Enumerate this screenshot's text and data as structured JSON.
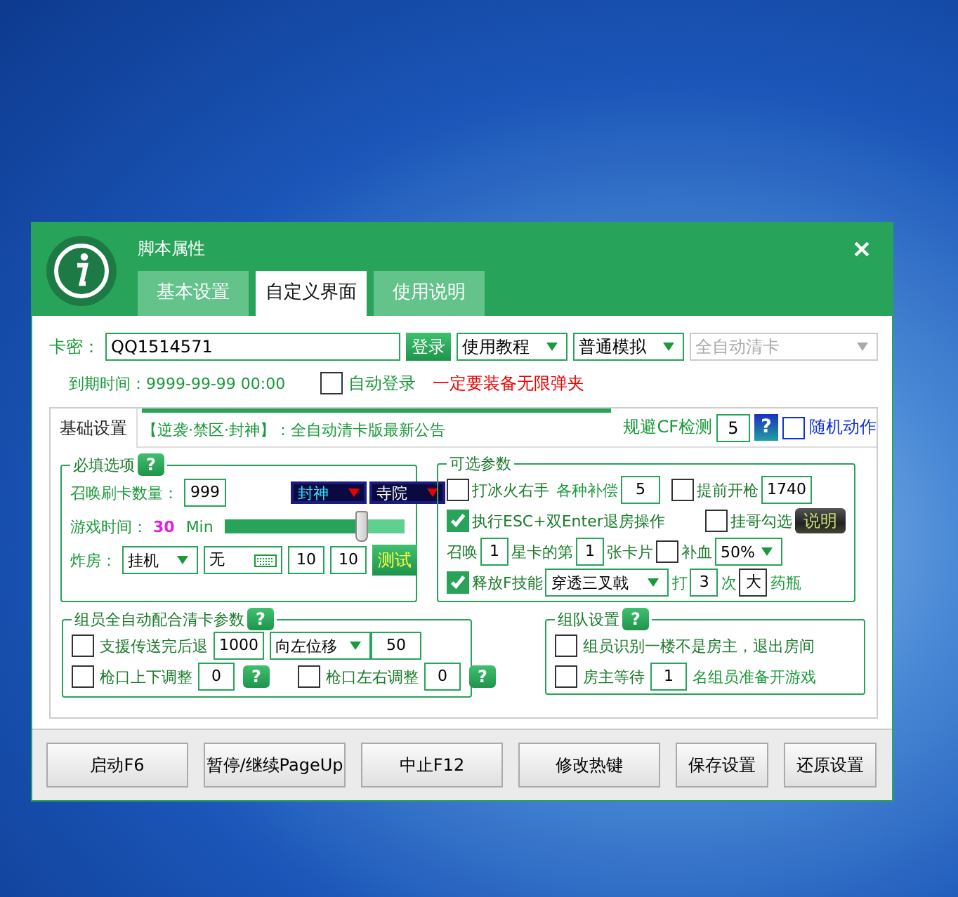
{
  "window": {
    "title": "脚本属性"
  },
  "tabs": [
    {
      "label": "基本设置",
      "selected": false
    },
    {
      "label": "自定义界面",
      "selected": true
    },
    {
      "label": "使用说明",
      "selected": false
    }
  ],
  "card": {
    "label": "卡密：",
    "value": "QQ1514571",
    "login_button": "登录",
    "dropdowns": [
      {
        "value": "使用教程",
        "disabled": false
      },
      {
        "value": "普通模拟",
        "disabled": false
      },
      {
        "value": "全自动清卡",
        "disabled": true
      }
    ]
  },
  "expiry": {
    "label": "到期时间：",
    "value": "9999-99-99 00:00"
  },
  "auto_login": {
    "label": "自动登录",
    "checked": false
  },
  "warning": "一定要装备无限弹夹",
  "subtabs": [
    {
      "label": "基础设置",
      "selected": true
    }
  ],
  "notice": "【逆袭·禁区·封神】：全自动清卡版最新公告",
  "cf_detect": {
    "label": "规避CF检测",
    "value": "5",
    "help": "?"
  },
  "random_action": {
    "label": "随机动作",
    "checked": false
  },
  "required": {
    "title": "必填选项",
    "help": "?",
    "mode_selects": [
      "封神",
      "寺院"
    ],
    "summon_count": {
      "label": "召唤刷卡数量：",
      "value": "999"
    },
    "game_time": {
      "label": "游戏时间：",
      "value": "30",
      "unit": "Min",
      "level": 0.76
    },
    "bomb": {
      "label": "炸房：",
      "mode": "挂机",
      "key": "无",
      "values": [
        "10",
        "10"
      ],
      "test_button": "测试"
    }
  },
  "optional": {
    "title": "可选参数",
    "ice_fire": {
      "label": "打冰火右手",
      "checked": false
    },
    "compensation": {
      "label": "各种补偿",
      "value": "5"
    },
    "early_fire": {
      "label": "提前开枪",
      "checked": false,
      "value": "1740"
    },
    "esc_enter": {
      "label": "执行ESC+双Enter退房操作",
      "checked": true
    },
    "hang_check": {
      "label": "挂哥勾选",
      "checked": false
    },
    "explain_button": "说明",
    "summon": {
      "parts": [
        "召唤",
        "星卡的第",
        "张卡片"
      ],
      "values": [
        "1",
        "1"
      ]
    },
    "heal": {
      "label": "补血",
      "checked": false,
      "value": "50%"
    },
    "f_skill": {
      "label": "释放F技能",
      "checked": true,
      "value": "穿透三叉戟"
    },
    "hit": {
      "parts": [
        "打",
        "次",
        "药瓶"
      ],
      "count": "3",
      "size": "大"
    }
  },
  "team_auto": {
    "title": "组员全自动配合清卡参数",
    "help": "?",
    "support": {
      "label": "支援传送完后退",
      "checked": false,
      "value": "1000",
      "direction": "向左位移",
      "distance": "50"
    },
    "muzzle_vertical": {
      "label": "枪口上下调整",
      "checked": false,
      "value": "0",
      "help": "?"
    },
    "muzzle_horizontal": {
      "label": "枪口左右调整",
      "checked": false,
      "value": "0",
      "help": "?"
    }
  },
  "team": {
    "title": "组队设置",
    "help": "?",
    "member_check": {
      "label": "组员识别一楼不是房主，退出房间",
      "checked": false
    },
    "host_wait": {
      "label": "房主等待",
      "checked": false,
      "value": "1",
      "suffix": "名组员准备开游戏"
    }
  },
  "buttons": [
    "启动F6",
    "暂停/继续PageUp",
    "中止F12",
    "修改热键",
    "保存设置",
    "还原设置"
  ]
}
